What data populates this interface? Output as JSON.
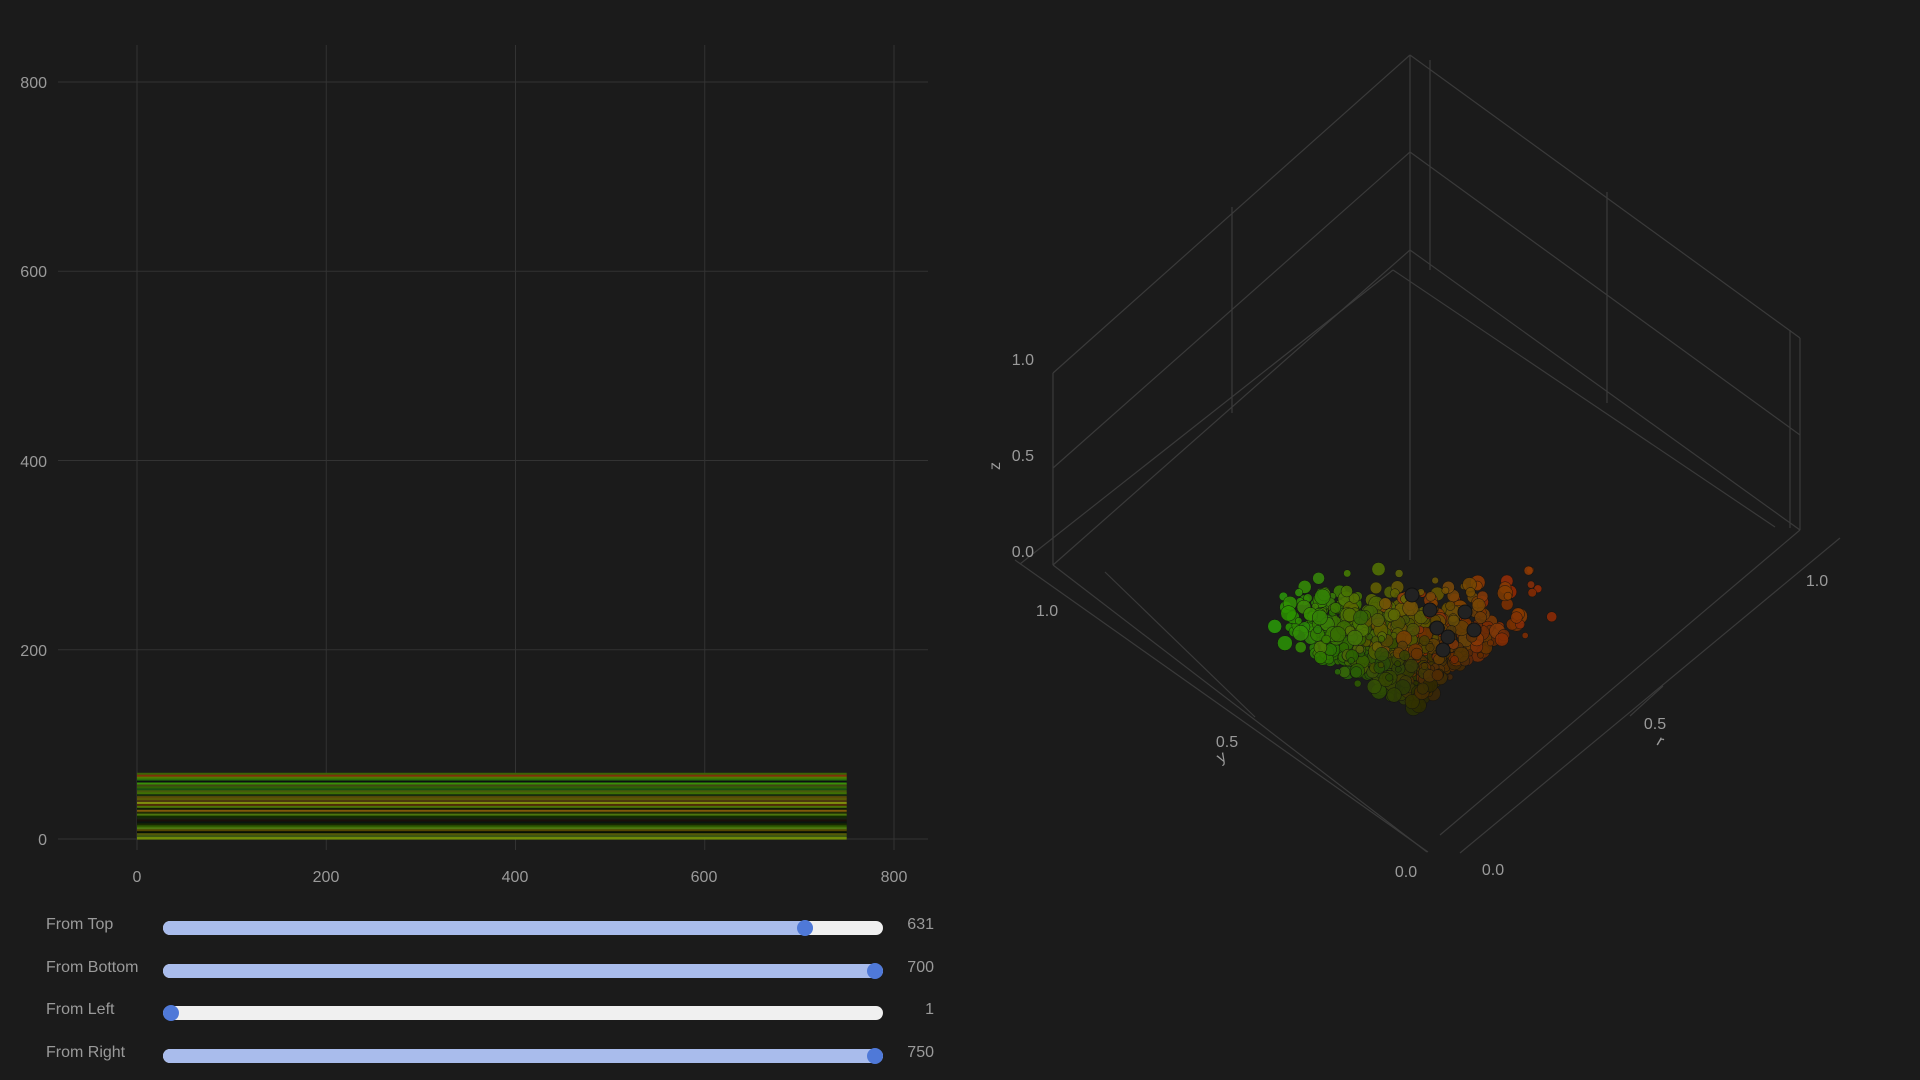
{
  "plot2d": {
    "x_ticks": [
      "0",
      "200",
      "400",
      "600",
      "800"
    ],
    "y_ticks": [
      "0",
      "200",
      "400",
      "600",
      "800"
    ],
    "image_extent": {
      "x": [
        0,
        750
      ],
      "y": [
        0,
        70
      ]
    }
  },
  "plot3d": {
    "axis_labels": {
      "x": "r",
      "y": "y",
      "z": "z"
    },
    "z_ticks": [
      "0.0",
      "0.5",
      "1.0"
    ],
    "y_ticks": [
      "1.0",
      "0.5",
      "0.0"
    ],
    "x_ticks": [
      "0.0",
      "0.5",
      "1.0"
    ]
  },
  "sliders": [
    {
      "label": "From Top",
      "value": "631",
      "fraction": 0.9
    },
    {
      "label": "From Bottom",
      "value": "700",
      "fraction": 1.0
    },
    {
      "label": "From Left",
      "value": "1",
      "fraction": 0.0
    },
    {
      "label": "From Right",
      "value": "750",
      "fraction": 1.0
    }
  ],
  "colors": {
    "background": "#1b1b1b",
    "grid": "#333333",
    "slider_fill": "#a9bcec",
    "slider_track": "#f0f0f0",
    "slider_thumb": "#4f79d8"
  }
}
